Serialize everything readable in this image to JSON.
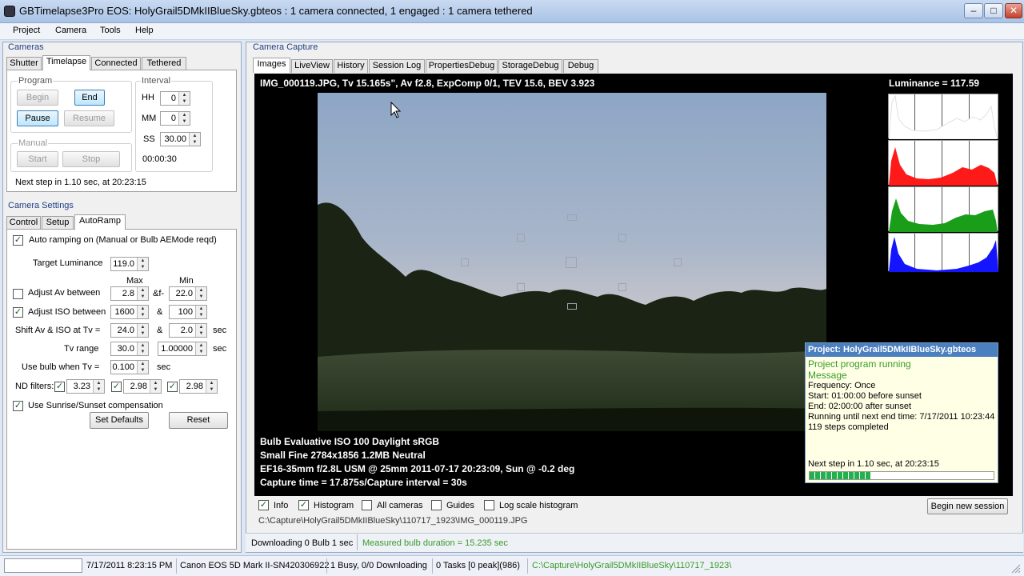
{
  "window": {
    "title": "GBTimelapse3Pro EOS: HolyGrail5DMkIIBlueSky.gbteos : 1 camera connected, 1 engaged : 1 camera tethered"
  },
  "menu": [
    "Project",
    "Camera",
    "Tools",
    "Help"
  ],
  "cameras": {
    "title": "Cameras",
    "tabs": [
      "Shutter",
      "Timelapse",
      "Connected",
      "Tethered"
    ],
    "program": {
      "title": "Program",
      "begin": "Begin",
      "end": "End",
      "pause": "Pause",
      "resume": "Resume"
    },
    "manual": {
      "title": "Manual",
      "start": "Start",
      "stop": "Stop"
    },
    "interval": {
      "title": "Interval",
      "hh_label": "HH",
      "hh": "0",
      "mm_label": "MM",
      "mm": "0",
      "ss_label": "SS",
      "ss": "30.00",
      "time": "00:00:30"
    },
    "next_step": "Next step in 1.10 sec, at 20:23:15"
  },
  "settings": {
    "title": "Camera Settings",
    "tabs": [
      "Control",
      "Setup",
      "AutoRamp"
    ],
    "auto_ramping": "Auto ramping on (Manual or Bulb AEMode reqd)",
    "target_lum_label": "Target Luminance",
    "target_lum": "119.0",
    "max_label": "Max",
    "min_label": "Min",
    "adjust_av": "Adjust Av between",
    "av_max": "2.8",
    "av_sep": "&f-",
    "av_min": "22.0",
    "adjust_iso": "Adjust ISO between",
    "iso_max": "1600",
    "iso_sep": "&",
    "iso_min": "100",
    "shift_label": "Shift Av & ISO at Tv =",
    "shift_max": "24.0",
    "shift_sep": "&",
    "shift_min": "2.0",
    "shift_unit": "sec",
    "tv_range_label": "Tv range",
    "tv_max": "30.0",
    "tv_min": "1.00000",
    "tv_unit": "sec",
    "bulb_label": "Use bulb when Tv =",
    "bulb_val": "0.100",
    "bulb_unit": "sec",
    "nd_label": "ND filters:",
    "nd1": "3.23",
    "nd2": "2.98",
    "nd3": "2.98",
    "sunrise": "Use Sunrise/Sunset compensation",
    "set_defaults": "Set Defaults",
    "reset": "Reset"
  },
  "capture": {
    "title": "Camera Capture",
    "tabs": [
      "Images",
      "LiveView",
      "History",
      "Session Log",
      "PropertiesDebug",
      "StorageDebug",
      "Debug"
    ],
    "image_info": "IMG_000119.JPG, Tv 15.165s\", Av f2.8, ExpComp 0/1, TEV 15.6, BEV 3.923",
    "luminance": "Luminance = 117.59",
    "line1": "Bulb    Evaluative    ISO 100    Daylight    sRGB",
    "line2": "Small Fine    2784x1856    1.2MB    Neutral",
    "line3": "EF16-35mm f/2.8L USM @ 25mm  2011-07-17 20:23:09, Sun @ -0.2 deg",
    "line4": "Capture time = 17.875s/Capture interval = 30s",
    "project_box": {
      "title": "Project: HolyGrail5DMkIIBlueSky.gbteos",
      "status": "Project program running",
      "message": "Message",
      "frequency": "Frequency: Once",
      "start": "Start: 01:00:00 before sunset",
      "end": "End: 02:00:00 after sunset",
      "running": "Running until next end time: 7/17/2011 10:23:44",
      "steps": "119 steps completed",
      "next": "Next step in 1.10 sec, at 20:23:15",
      "progress": 0.33
    },
    "options": {
      "info": "Info",
      "histogram": "Histogram",
      "all_cameras": "All cameras",
      "guides": "Guides",
      "log_hist": "Log scale histogram"
    },
    "begin_session": "Begin new session",
    "path": "C:\\Capture\\HolyGrail5DMkIIBlueSky\\110717_1923\\IMG_000119.JPG",
    "downloading": "Downloading 0  Bulb 1 sec",
    "bulb_duration": "Measured bulb duration = 15.235 sec"
  },
  "status": {
    "datetime": "7/17/2011 8:23:15 PM",
    "camera": "Canon EOS 5D Mark II-SN420306922",
    "busy": "1 Busy, 0/0 Downloading",
    "tasks": "0 Tasks [0 peak](986)",
    "path": "C:\\Capture\\HolyGrail5DMkIIBlueSky\\110717_1923\\"
  },
  "colors": {
    "accent": "#1e3f86",
    "green_text": "#3a9a2a",
    "progress": "#22b14c"
  }
}
